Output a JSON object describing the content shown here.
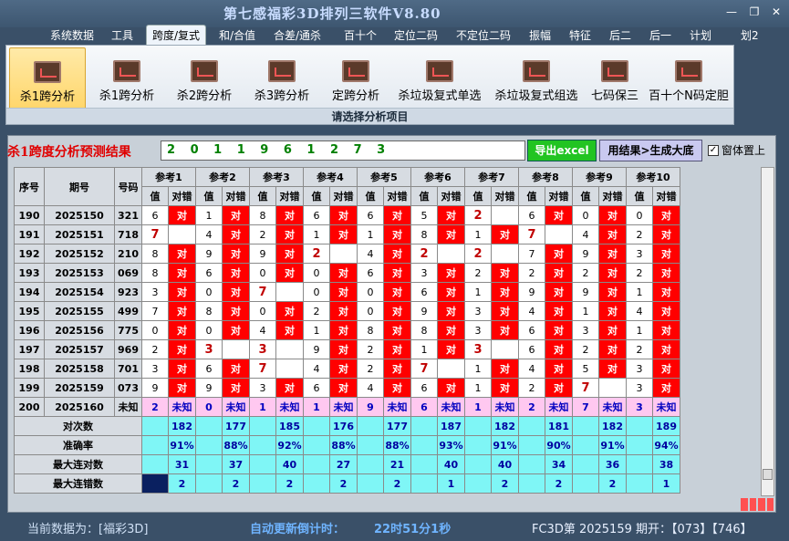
{
  "app": {
    "title": "第七感福彩3D排列三软件V8.80",
    "minimize": "—",
    "restore": "❐",
    "close": "✕"
  },
  "menu": [
    "系统数据",
    "工具",
    "跨度/复式",
    "和/合值",
    "合差/通杀",
    "百十个",
    "定位二码",
    "不定位二码",
    "振幅",
    "特征",
    "后二",
    "后一",
    "计划",
    "划2"
  ],
  "ribbon": {
    "buttons": [
      "杀1跨分析",
      "杀1跨分析",
      "杀2跨分析",
      "杀3跨分析",
      "定跨分析",
      "杀垃圾复式单选",
      "杀垃圾复式组选",
      "七码保三",
      "百十个N码定胆"
    ],
    "caption": "请选择分析项目",
    "icon": "chart-icon"
  },
  "result": {
    "label": "杀1跨度分析预测结果",
    "value": "2 0 1 1 9 6 1 2 7 3"
  },
  "buttons": {
    "excel": "导出excel",
    "generate": "用结果>生成大底",
    "ontop": "窗体置上",
    "ontop_mark": "✓"
  },
  "table": {
    "headers": [
      "序号",
      "期号",
      "号码"
    ],
    "refs": [
      "参考1",
      "参考2",
      "参考3",
      "参考4",
      "参考5",
      "参考6",
      "参考7",
      "参考8",
      "参考9",
      "参考10"
    ],
    "sub": [
      "值",
      "对错"
    ],
    "rows": [
      {
        "no": "190",
        "issue": "2025150",
        "num": "321",
        "c": [
          [
            "6",
            "对"
          ],
          [
            "1",
            "对"
          ],
          [
            "8",
            "对"
          ],
          [
            "6",
            "对"
          ],
          [
            "6",
            "对"
          ],
          [
            "5",
            "对"
          ],
          [
            "2",
            ""
          ],
          [
            "6",
            "对"
          ],
          [
            "0",
            "对"
          ],
          [
            "0",
            "对"
          ]
        ]
      },
      {
        "no": "191",
        "issue": "2025151",
        "num": "718",
        "c": [
          [
            "7",
            ""
          ],
          [
            "4",
            "对"
          ],
          [
            "2",
            "对"
          ],
          [
            "1",
            "对"
          ],
          [
            "1",
            "对"
          ],
          [
            "8",
            "对"
          ],
          [
            "1",
            "对"
          ],
          [
            "7",
            ""
          ],
          [
            "4",
            "对"
          ],
          [
            "2",
            "对"
          ]
        ]
      },
      {
        "no": "192",
        "issue": "2025152",
        "num": "210",
        "c": [
          [
            "8",
            "对"
          ],
          [
            "9",
            "对"
          ],
          [
            "9",
            "对"
          ],
          [
            "2",
            ""
          ],
          [
            "4",
            "对"
          ],
          [
            "2",
            ""
          ],
          [
            "2",
            ""
          ],
          [
            "7",
            "对"
          ],
          [
            "9",
            "对"
          ],
          [
            "3",
            "对"
          ]
        ]
      },
      {
        "no": "193",
        "issue": "2025153",
        "num": "069",
        "c": [
          [
            "8",
            "对"
          ],
          [
            "6",
            "对"
          ],
          [
            "0",
            "对"
          ],
          [
            "0",
            "对"
          ],
          [
            "6",
            "对"
          ],
          [
            "3",
            "对"
          ],
          [
            "2",
            "对"
          ],
          [
            "2",
            "对"
          ],
          [
            "2",
            "对"
          ],
          [
            "2",
            "对"
          ]
        ]
      },
      {
        "no": "194",
        "issue": "2025154",
        "num": "923",
        "c": [
          [
            "3",
            "对"
          ],
          [
            "0",
            "对"
          ],
          [
            "7",
            ""
          ],
          [
            "0",
            "对"
          ],
          [
            "0",
            "对"
          ],
          [
            "6",
            "对"
          ],
          [
            "1",
            "对"
          ],
          [
            "9",
            "对"
          ],
          [
            "9",
            "对"
          ],
          [
            "1",
            "对"
          ]
        ]
      },
      {
        "no": "195",
        "issue": "2025155",
        "num": "499",
        "c": [
          [
            "7",
            "对"
          ],
          [
            "8",
            "对"
          ],
          [
            "0",
            "对"
          ],
          [
            "2",
            "对"
          ],
          [
            "0",
            "对"
          ],
          [
            "9",
            "对"
          ],
          [
            "3",
            "对"
          ],
          [
            "4",
            "对"
          ],
          [
            "1",
            "对"
          ],
          [
            "4",
            "对"
          ]
        ]
      },
      {
        "no": "196",
        "issue": "2025156",
        "num": "775",
        "c": [
          [
            "0",
            "对"
          ],
          [
            "0",
            "对"
          ],
          [
            "4",
            "对"
          ],
          [
            "1",
            "对"
          ],
          [
            "8",
            "对"
          ],
          [
            "8",
            "对"
          ],
          [
            "3",
            "对"
          ],
          [
            "6",
            "对"
          ],
          [
            "3",
            "对"
          ],
          [
            "1",
            "对"
          ]
        ]
      },
      {
        "no": "197",
        "issue": "2025157",
        "num": "969",
        "c": [
          [
            "2",
            "对"
          ],
          [
            "3",
            ""
          ],
          [
            "3",
            ""
          ],
          [
            "9",
            "对"
          ],
          [
            "2",
            "对"
          ],
          [
            "1",
            "对"
          ],
          [
            "3",
            ""
          ],
          [
            "6",
            "对"
          ],
          [
            "2",
            "对"
          ],
          [
            "2",
            "对"
          ]
        ]
      },
      {
        "no": "198",
        "issue": "2025158",
        "num": "701",
        "c": [
          [
            "3",
            "对"
          ],
          [
            "6",
            "对"
          ],
          [
            "7",
            ""
          ],
          [
            "4",
            "对"
          ],
          [
            "2",
            "对"
          ],
          [
            "7",
            ""
          ],
          [
            "1",
            "对"
          ],
          [
            "4",
            "对"
          ],
          [
            "5",
            "对"
          ],
          [
            "3",
            "对"
          ]
        ]
      },
      {
        "no": "199",
        "issue": "2025159",
        "num": "073",
        "c": [
          [
            "9",
            "对"
          ],
          [
            "9",
            "对"
          ],
          [
            "3",
            "对"
          ],
          [
            "6",
            "对"
          ],
          [
            "4",
            "对"
          ],
          [
            "6",
            "对"
          ],
          [
            "1",
            "对"
          ],
          [
            "2",
            "对"
          ],
          [
            "7",
            ""
          ],
          [
            "3",
            "对"
          ]
        ]
      }
    ],
    "last_row": {
      "no": "200",
      "issue": "2025160",
      "num": "未知",
      "c": [
        [
          "2",
          "未知"
        ],
        [
          "0",
          "未知"
        ],
        [
          "1",
          "未知"
        ],
        [
          "1",
          "未知"
        ],
        [
          "9",
          "未知"
        ],
        [
          "6",
          "未知"
        ],
        [
          "1",
          "未知"
        ],
        [
          "2",
          "未知"
        ],
        [
          "7",
          "未知"
        ],
        [
          "3",
          "未知"
        ]
      ]
    },
    "summary": [
      {
        "label": "对次数",
        "values": [
          "182",
          "177",
          "185",
          "176",
          "177",
          "187",
          "182",
          "181",
          "182",
          "189"
        ]
      },
      {
        "label": "准确率",
        "values": [
          "91%",
          "88%",
          "92%",
          "88%",
          "88%",
          "93%",
          "91%",
          "90%",
          "91%",
          "94%"
        ]
      },
      {
        "label": "最大连对数",
        "values": [
          "31",
          "37",
          "40",
          "27",
          "21",
          "40",
          "40",
          "34",
          "36",
          "38"
        ]
      },
      {
        "label": "最大连错数",
        "values": [
          "2",
          "2",
          "2",
          "2",
          "2",
          "1",
          "2",
          "2",
          "2",
          "1"
        ]
      }
    ]
  },
  "status": {
    "current_data": "当前数据为：[福彩3D]",
    "countdown_label": "自动更新倒计时：",
    "countdown": "22时51分1秒",
    "issue_info": "FC3D第 2025159 期开：【073】【746】"
  },
  "colors": {
    "hit": "#ff0000",
    "miss_value": "#c00000",
    "unknown_row": "#ffc8f0",
    "summary": "#7ff6f6",
    "accent_green": "#22c422"
  }
}
